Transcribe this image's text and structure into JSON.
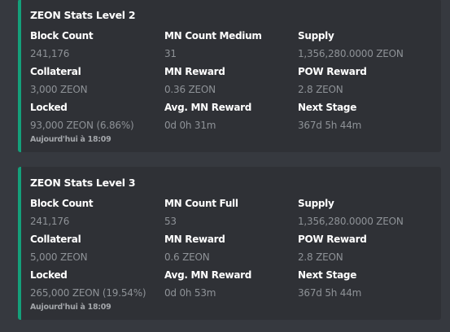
{
  "colors": {
    "accent": "#14a07a",
    "embed_bg": "#2f3136",
    "page_bg": "#36393f"
  },
  "embeds": [
    {
      "title": "ZEON Stats Level 2",
      "fields": [
        {
          "name": "Block Count",
          "value": "241,176"
        },
        {
          "name": "MN Count Medium",
          "value": "31"
        },
        {
          "name": "Supply",
          "value": "1,356,280.0000 ZEON"
        },
        {
          "name": "Collateral",
          "value": "3,000 ZEON"
        },
        {
          "name": "MN Reward",
          "value": "0.36 ZEON"
        },
        {
          "name": "POW Reward",
          "value": "2.8 ZEON"
        },
        {
          "name": "Locked",
          "value": "93,000 ZEON (6.86%)"
        },
        {
          "name": "Avg. MN Reward",
          "value": "0d 0h 31m"
        },
        {
          "name": "Next Stage",
          "value": "367d 5h 44m"
        }
      ],
      "footer": "Aujourd'hui à 18:09"
    },
    {
      "title": "ZEON Stats Level 3",
      "fields": [
        {
          "name": "Block Count",
          "value": "241,176"
        },
        {
          "name": "MN Count Full",
          "value": "53"
        },
        {
          "name": "Supply",
          "value": "1,356,280.0000 ZEON"
        },
        {
          "name": "Collateral",
          "value": "5,000 ZEON"
        },
        {
          "name": "MN Reward",
          "value": "0.6 ZEON"
        },
        {
          "name": "POW Reward",
          "value": "2.8 ZEON"
        },
        {
          "name": "Locked",
          "value": "265,000 ZEON (19.54%)"
        },
        {
          "name": "Avg. MN Reward",
          "value": "0d 0h 53m"
        },
        {
          "name": "Next Stage",
          "value": "367d 5h 44m"
        }
      ],
      "footer": "Aujourd'hui à 18:09"
    }
  ]
}
